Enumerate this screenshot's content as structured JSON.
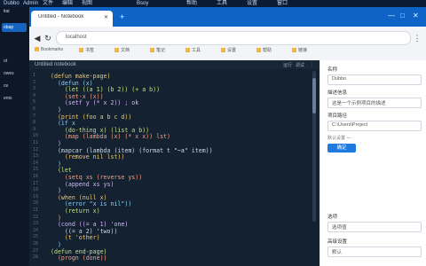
{
  "os_top": [
    "Dubbo",
    "Admin",
    "文件",
    "编辑",
    "视图",
    "Bsoy",
    "帮助",
    "工具",
    "设置",
    "窗口"
  ],
  "sidebar": {
    "items": [
      "itat",
      "obap",
      "ot",
      "owes",
      "ce",
      "ents"
    ]
  },
  "browser": {
    "tab_title": "Untitled - Notebook",
    "tab_close": "✕",
    "new_tab": "+",
    "window_controls": [
      "—",
      "□",
      "✕"
    ],
    "url": "localhost",
    "bookmarks": [
      "Bookmarks",
      "书签",
      "文档",
      "笔记",
      "工具",
      "设置",
      "帮助",
      "链接"
    ]
  },
  "code": {
    "title": "Untitled notebook",
    "actions": [
      "运行",
      "调试",
      "⋮"
    ],
    "lines": [
      "(defun make-page)",
      "  (defun (x)",
      "    (let ((a 1) (b 2)) (+ a b))",
      "    (set-x (x))",
      "    (setf y (* x 2)) ; ok",
      "  )",
      "  (print (foo a b c d))",
      "  (if x",
      "    (do-thing x) (list a b))",
      "    (map (lambda (x) (* x x)) lst)",
      "  )",
      "  (mapcar (lambda (item) (format t \"~a\" item))",
      "    (remove nil lst))",
      "  )",
      "  (let",
      "    (setq xs (reverse ys))",
      "    (append xs ys)",
      "  )",
      "  (when (null x)",
      "    (error \"x is nil\"))",
      "    (return x)",
      "  )",
      "  (cond ((= a 1) 'one)",
      "    ((= a 2) 'two))",
      "    (t 'other)",
      "  )",
      "(defun end-page)",
      "  (progn (done))"
    ],
    "line_numbers": [
      "1",
      "2",
      "3",
      "4",
      "5",
      "6",
      "7",
      "8",
      "9",
      "10",
      "11",
      "12",
      "13",
      "14",
      "15",
      "16",
      "17",
      "18",
      "19",
      "20",
      "21",
      "22",
      "23",
      "24",
      "25",
      "26",
      "27",
      "28"
    ]
  },
  "settings": {
    "label1": "名称",
    "value1": "Dubbo",
    "label2": "描述信息",
    "value2": "这是一个示例项目的描述",
    "label3": "项目路径",
    "value3": "C:\\Users\\Project",
    "hint": "默认设置 —",
    "button": "确定",
    "label4": "选项",
    "value4": "选项值",
    "label5": "高级设置",
    "value5": "默认"
  }
}
